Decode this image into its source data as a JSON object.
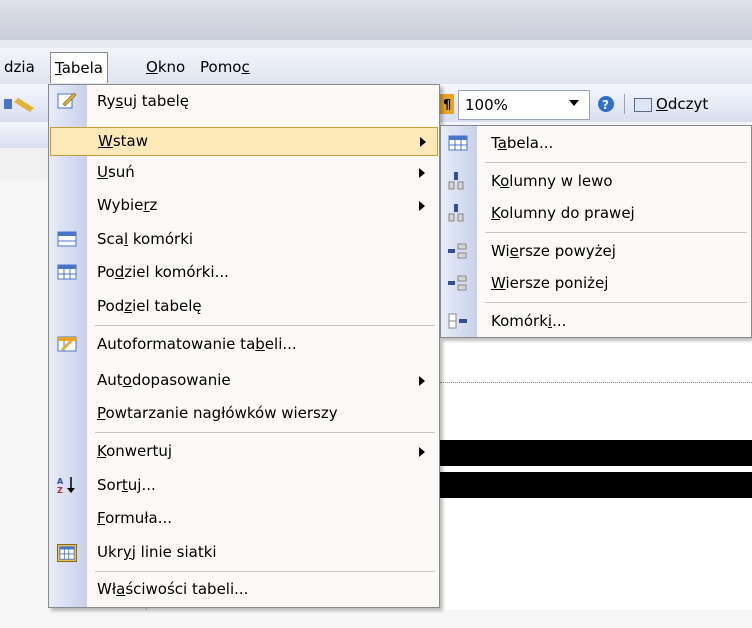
{
  "menubar": {
    "items": [
      {
        "label_pre": "",
        "label_u": "",
        "label_post": "dzia"
      },
      {
        "label_pre": "",
        "label_u": "T",
        "label_post": "abela"
      },
      {
        "label_pre": "",
        "label_u": "O",
        "label_post": "kno"
      },
      {
        "label_pre": "Pomo",
        "label_u": "c",
        "label_post": ""
      }
    ]
  },
  "toolbar": {
    "zoom": "100%",
    "read_pre": "",
    "read_u": "O",
    "read_post": "dczyt"
  },
  "menu": {
    "items": [
      {
        "pre": "Ry",
        "u": "s",
        "post": "uj tabelę",
        "icon": "draw-table-icon",
        "submenu": false
      },
      {
        "pre": "",
        "u": "W",
        "post": "staw",
        "icon": "",
        "submenu": true,
        "highlighted": true
      },
      {
        "pre": "",
        "u": "U",
        "post": "suń",
        "icon": "",
        "submenu": true
      },
      {
        "pre": "Wybie",
        "u": "r",
        "post": "z",
        "icon": "",
        "submenu": true
      },
      {
        "pre": "Sca",
        "u": "l",
        "post": " komórki",
        "icon": "merge-cells-icon",
        "submenu": false
      },
      {
        "pre": "Po",
        "u": "d",
        "post": "ziel komórki...",
        "icon": "split-cells-icon",
        "submenu": false
      },
      {
        "pre": "Pod",
        "u": "z",
        "post": "iel tabelę",
        "icon": "",
        "submenu": false
      },
      {
        "pre": "Autoformatowanie ta",
        "u": "b",
        "post": "eli...",
        "icon": "autoformat-icon",
        "submenu": false
      },
      {
        "pre": "Aut",
        "u": "o",
        "post": "dopasowanie",
        "icon": "",
        "submenu": true
      },
      {
        "pre": "",
        "u": "P",
        "post": "owtarzanie nagłówków wierszy",
        "icon": "",
        "submenu": false
      },
      {
        "pre": "",
        "u": "K",
        "post": "onwertuj",
        "icon": "",
        "submenu": true
      },
      {
        "pre": "Sor",
        "u": "t",
        "post": "uj...",
        "icon": "sort-icon",
        "submenu": false
      },
      {
        "pre": "",
        "u": "F",
        "post": "ormuła...",
        "icon": "",
        "submenu": false
      },
      {
        "pre": "Ukr",
        "u": "y",
        "post": "j linie siatki",
        "icon": "gridlines-icon",
        "submenu": false
      },
      {
        "pre": "Wł",
        "u": "a",
        "post": "ściwości tabeli...",
        "icon": "",
        "submenu": false
      }
    ]
  },
  "submenu": {
    "items": [
      {
        "pre": "T",
        "u": "a",
        "post": "bela...",
        "icon": "insert-table-icon"
      },
      {
        "pre": "K",
        "u": "o",
        "post": "lumny w lewo",
        "icon": "columns-left-icon"
      },
      {
        "pre": "",
        "u": "K",
        "post": "olumny do prawej",
        "icon": "columns-right-icon"
      },
      {
        "pre": "Wi",
        "u": "e",
        "post": "rsze powyżej",
        "icon": "rows-above-icon"
      },
      {
        "pre": "",
        "u": "W",
        "post": "iersze poniżej",
        "icon": "rows-below-icon"
      },
      {
        "pre": "Komórk",
        "u": "i",
        "post": "...",
        "icon": "insert-cells-icon"
      }
    ]
  },
  "colors": {
    "highlight": "#fde9b7",
    "highlight_border": "#c49a3b",
    "icon_column": "#c8d1ea"
  }
}
